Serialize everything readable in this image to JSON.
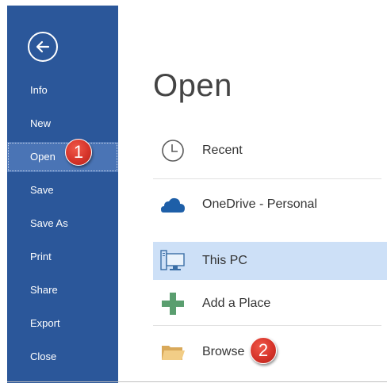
{
  "sidebar": {
    "back_icon": "back-arrow-icon",
    "items": [
      {
        "label": "Info"
      },
      {
        "label": "New"
      },
      {
        "label": "Open",
        "selected": true
      },
      {
        "label": "Save"
      },
      {
        "label": "Save As"
      },
      {
        "label": "Print"
      },
      {
        "label": "Share"
      },
      {
        "label": "Export"
      },
      {
        "label": "Close"
      }
    ],
    "colors": {
      "background": "#2b579a",
      "selected": "#4a74b5",
      "text": "#ffffff"
    }
  },
  "main": {
    "title": "Open",
    "items": [
      {
        "label": "Recent",
        "icon": "clock-icon"
      },
      {
        "label": "OneDrive - Personal",
        "icon": "cloud-icon"
      },
      {
        "label": "This PC",
        "icon": "computer-icon",
        "selected": true
      },
      {
        "label": "Add a Place",
        "icon": "plus-icon"
      },
      {
        "label": "Browse",
        "icon": "folder-icon"
      }
    ],
    "colors": {
      "selected": "#cde0f7",
      "plus": "#5a9e6f",
      "folder": "#e8b96a"
    }
  },
  "annotations": [
    {
      "number": "1",
      "target": "Open"
    },
    {
      "number": "2",
      "target": "Browse"
    }
  ]
}
